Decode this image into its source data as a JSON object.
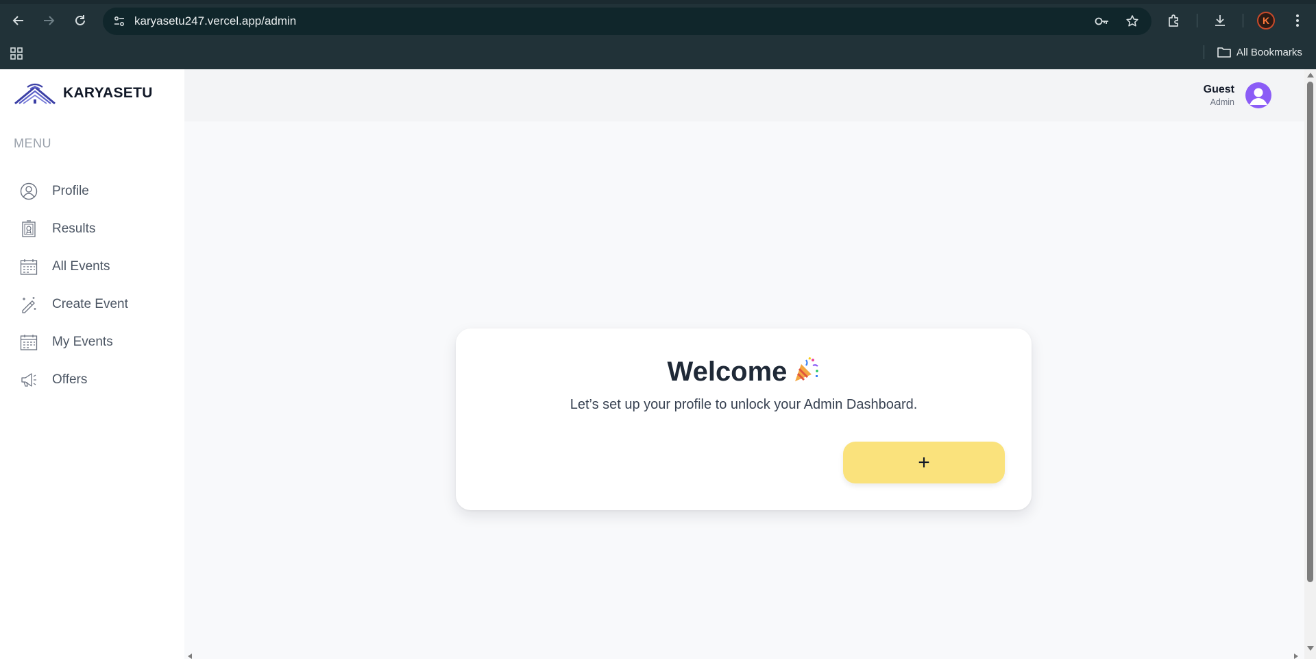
{
  "browser": {
    "url": "karyasetu247.vercel.app/admin",
    "bookmarks_label": "All Bookmarks",
    "profile_initial": "K"
  },
  "brand": {
    "name": "KARYASETU",
    "accent_color": "#3b3fa5"
  },
  "sidebar": {
    "menu_heading": "MENU",
    "items": [
      {
        "label": "Profile",
        "icon": "user-circle-icon"
      },
      {
        "label": "Results",
        "icon": "certificate-icon"
      },
      {
        "label": "All Events",
        "icon": "calendar-icon"
      },
      {
        "label": "Create Event",
        "icon": "magic-pen-icon"
      },
      {
        "label": "My Events",
        "icon": "calendar-icon"
      },
      {
        "label": "Offers",
        "icon": "megaphone-icon"
      }
    ]
  },
  "header": {
    "user_name": "Guest",
    "user_role": "Admin",
    "avatar_color": "#8b5cf6"
  },
  "welcome_card": {
    "title": "Welcome",
    "title_emoji": "party-popper-icon",
    "subtitle": "Let’s set up your profile to unlock your Admin Dashboard.",
    "add_button_label": "+",
    "add_button_color": "#fae27c"
  }
}
